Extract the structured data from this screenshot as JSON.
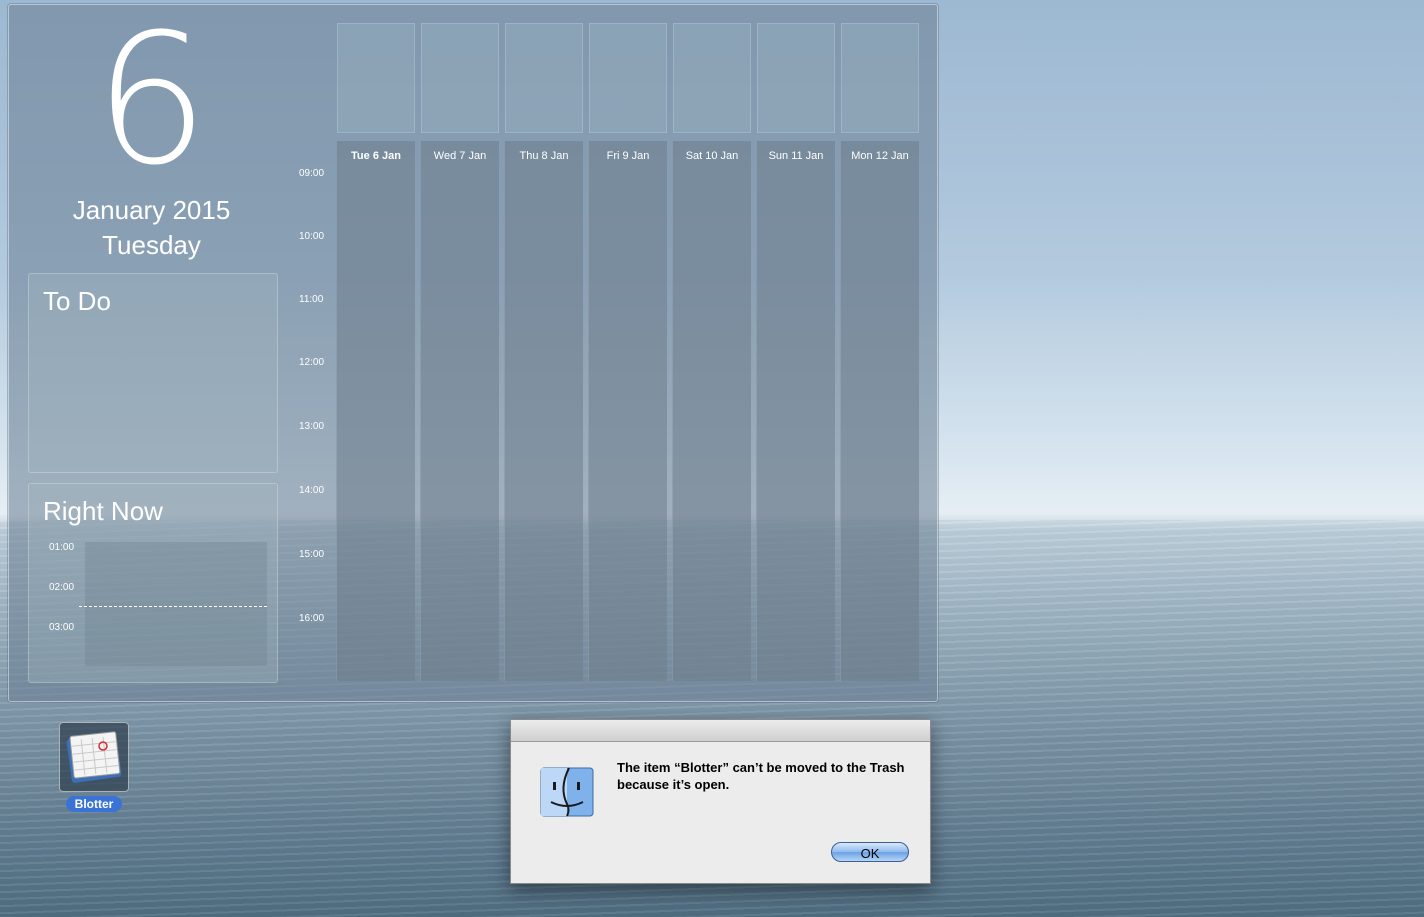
{
  "blotter": {
    "day_number": "6",
    "month_year": "January 2015",
    "weekday": "Tuesday",
    "todo_title": "To Do",
    "right_now": {
      "title": "Right Now",
      "times": [
        "01:00",
        "02:00",
        "03:00"
      ]
    },
    "hours": [
      "09:00",
      "10:00",
      "11:00",
      "12:00",
      "13:00",
      "14:00",
      "15:00",
      "16:00"
    ],
    "days": [
      "Tue 6 Jan",
      "Wed 7 Jan",
      "Thu 8 Jan",
      "Fri 9 Jan",
      "Sat 10 Jan",
      "Sun 11 Jan",
      "Mon 12 Jan"
    ]
  },
  "desktop_icon": {
    "label": "Blotter",
    "icon": "calendar-icon"
  },
  "dialog": {
    "icon": "finder-icon",
    "message": "The item “Blotter” can’t be moved to the Trash because it’s open.",
    "ok_label": "OK"
  }
}
